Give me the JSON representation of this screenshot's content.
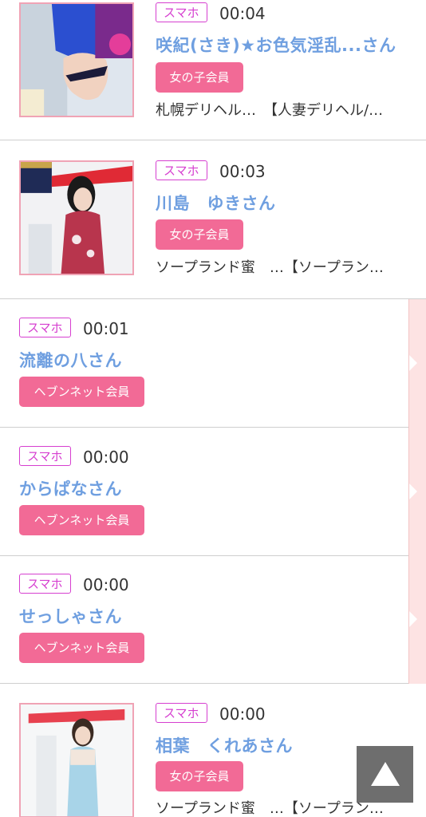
{
  "entries": [
    {
      "device": "スマホ",
      "time": "00:04",
      "name": "咲紀(さき)★お色気淫乱...さん",
      "member_type": "女の子会員",
      "shop_line": "札幌デリヘル…　【人妻デリヘル/…"
    },
    {
      "device": "スマホ",
      "time": "00:03",
      "name": "川島　ゆきさん",
      "member_type": "女の子会員",
      "shop_line": "ソープランド蜜　…【ソープラン…"
    },
    {
      "device": "スマホ",
      "time": "00:01",
      "name": "流離の八さん",
      "member_type": "ヘブンネット会員"
    },
    {
      "device": "スマホ",
      "time": "00:00",
      "name": "からぱなさん",
      "member_type": "ヘブンネット会員"
    },
    {
      "device": "スマホ",
      "time": "00:00",
      "name": "せっしゃさん",
      "member_type": "ヘブンネット会員"
    },
    {
      "device": "スマホ",
      "time": "00:00",
      "name": "相葉　くれあさん",
      "member_type": "女の子会員",
      "shop_line": "ソープランド蜜　…【ソープラン…"
    }
  ],
  "colors": {
    "name_link": "#6f9fe0",
    "device_tag": "#d63fd0",
    "member_badge": "#f26a96",
    "photo_border": "#f0a3b5",
    "side_strip": "#fde3e3"
  },
  "icons": {
    "scroll_top": "triangle-up-icon"
  }
}
